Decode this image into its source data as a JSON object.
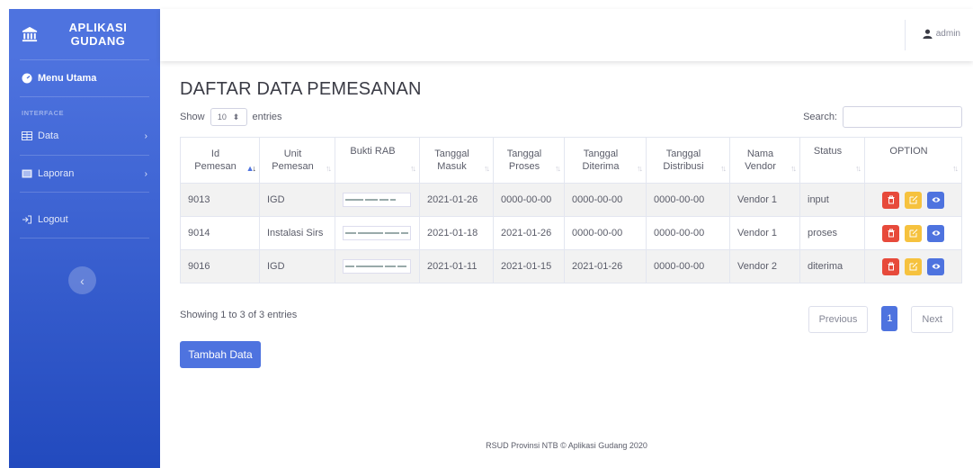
{
  "sidebar": {
    "brand_line1": "APLIKASI",
    "brand_line2": "GUDANG",
    "brand_icon": "bank-icon",
    "menu_utama": "Menu Utama",
    "heading": "INTERFACE",
    "data": "Data",
    "laporan": "Laporan",
    "logout": "Logout",
    "toggle_icon": "chevron-left-icon"
  },
  "topbar": {
    "user": "admin",
    "user_icon": "user-icon"
  },
  "main": {
    "title": "DAFTAR DATA PEMESANAN",
    "show": "Show",
    "entries_value": "10",
    "entries": "entries",
    "search_label": "Search:",
    "search_value": ""
  },
  "table": {
    "headers": [
      {
        "l1": "Id",
        "l2": "Pemesan"
      },
      {
        "l1": "Unit",
        "l2": "Pemesan"
      },
      {
        "l1": "Bukti RAB",
        "l2": ""
      },
      {
        "l1": "Tanggal",
        "l2": "Masuk"
      },
      {
        "l1": "Tanggal",
        "l2": "Proses"
      },
      {
        "l1": "Tanggal",
        "l2": "Diterima"
      },
      {
        "l1": "Tanggal",
        "l2": "Distribusi"
      },
      {
        "l1": "Nama",
        "l2": "Vendor"
      },
      {
        "l1": "Status",
        "l2": ""
      },
      {
        "l1": "OPTION",
        "l2": ""
      }
    ],
    "rows": [
      {
        "id": "9013",
        "unit": "IGD",
        "masuk": "2021-01-26",
        "proses": "0000-00-00",
        "diterima": "0000-00-00",
        "distribusi": "0000-00-00",
        "vendor": "Vendor 1",
        "status": "input"
      },
      {
        "id": "9014",
        "unit": "Instalasi Sirs",
        "masuk": "2021-01-18",
        "proses": "2021-01-26",
        "diterima": "0000-00-00",
        "distribusi": "0000-00-00",
        "vendor": "Vendor 1",
        "status": "proses"
      },
      {
        "id": "9016",
        "unit": "IGD",
        "masuk": "2021-01-11",
        "proses": "2021-01-15",
        "diterima": "2021-01-26",
        "distribusi": "0000-00-00",
        "vendor": "Vendor 2",
        "status": "diterima"
      }
    ]
  },
  "info": "Showing 1 to 3 of 3 entries",
  "pager": {
    "previous": "Previous",
    "current": "1",
    "next": "Next"
  },
  "add_button": "Tambah Data",
  "footer": "RSUD Provinsi NTB © Aplikasi Gudang 2020",
  "colors": {
    "primary": "#4e73df",
    "danger": "#e74a3b",
    "warning": "#f6c23e"
  }
}
